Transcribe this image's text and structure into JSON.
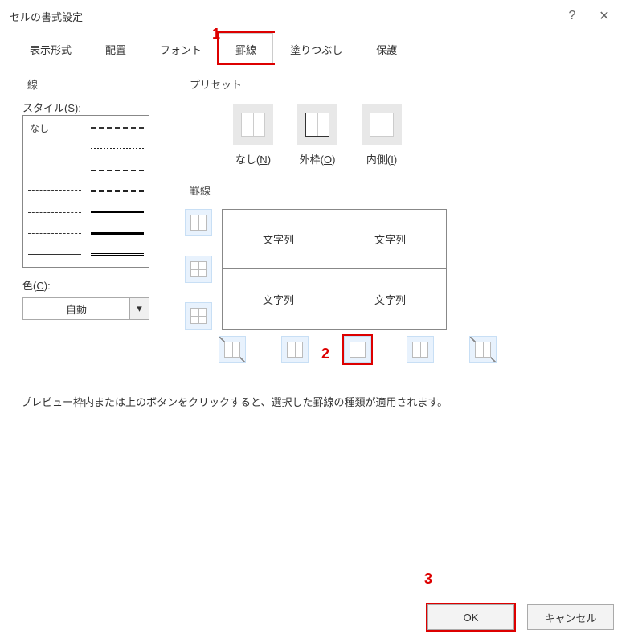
{
  "window": {
    "title": "セルの書式設定"
  },
  "tabs": {
    "display": "表示形式",
    "align": "配置",
    "font": "フォント",
    "border": "罫線",
    "fill": "塗りつぶし",
    "protect": "保護"
  },
  "line": {
    "group": "線",
    "style_label": "スタイル(",
    "style_key": "S",
    "style_suffix": "):",
    "none": "なし",
    "color_label": "色(",
    "color_key": "C",
    "color_suffix": "):",
    "color_value": "自動"
  },
  "preset": {
    "group": "プリセット",
    "none": "なし(",
    "none_key": "N",
    "outline": "外枠(",
    "outline_key": "O",
    "inside": "内側(",
    "inside_key": "I",
    "suffix": ")"
  },
  "border_group": "罫線",
  "preview_cell": "文字列",
  "note": "プレビュー枠内または上のボタンをクリックすると、選択した罫線の種類が適用されます。",
  "buttons": {
    "ok": "OK",
    "cancel": "キャンセル"
  },
  "annot": {
    "a1": "1",
    "a2": "2",
    "a3": "3"
  }
}
